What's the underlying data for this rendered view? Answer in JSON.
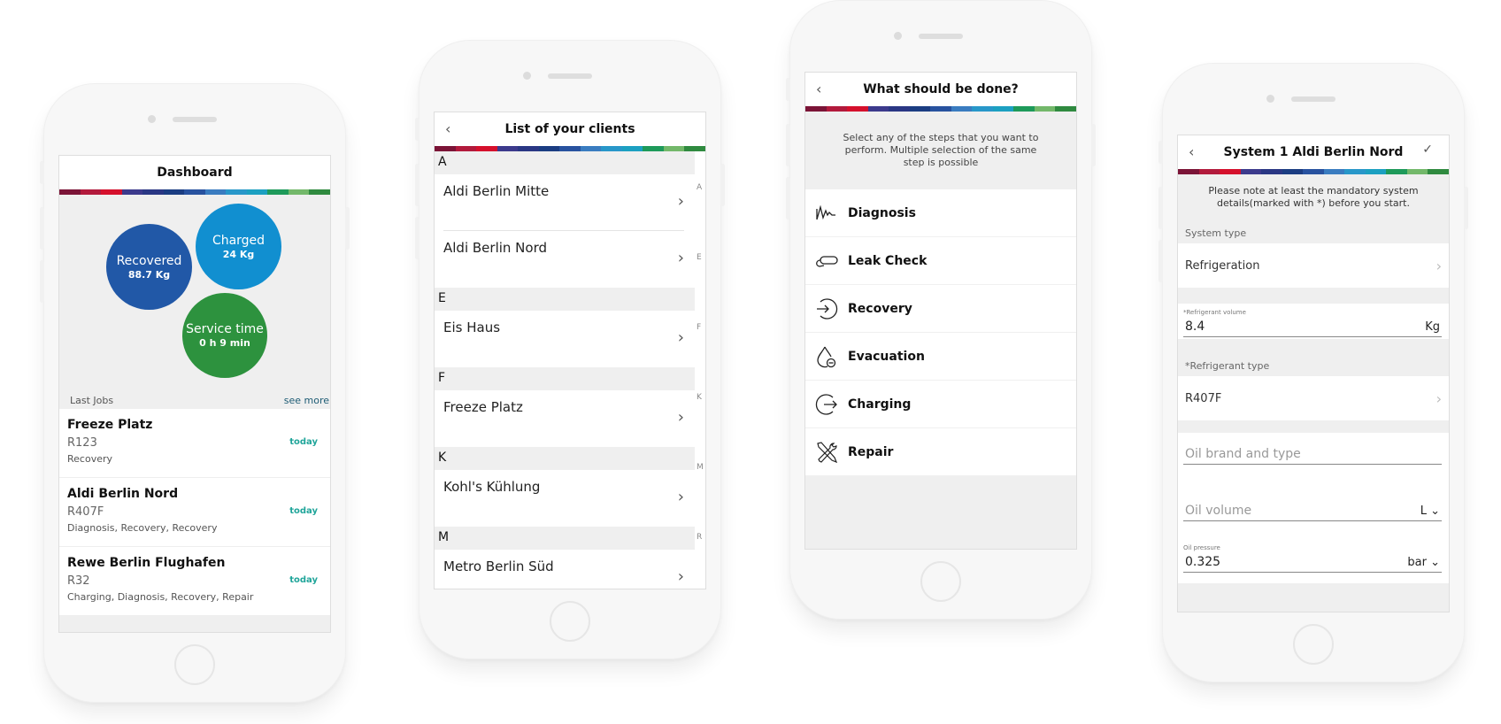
{
  "brand_bar": [
    "#7b1437",
    "#b21a3c",
    "#d5102c",
    "#3c3a8c",
    "#2a3784",
    "#1b3d82",
    "#28529f",
    "#3a7cc0",
    "#2897c9",
    "#1ca0c1",
    "#1e9a5a",
    "#73b86a",
    "#2f8a3f"
  ],
  "dashboard": {
    "title": "Dashboard",
    "bubbles": {
      "recovered": {
        "label": "Recovered",
        "value": "88.7 Kg",
        "color": "#2158a7"
      },
      "charged": {
        "label": "Charged",
        "value": "24 Kg",
        "color": "#118fd0"
      },
      "service": {
        "label": "Service time",
        "value": "0 h 9 min",
        "color": "#2d923e"
      }
    },
    "last_jobs_label": "Last Jobs",
    "see_more": "see more",
    "jobs": [
      {
        "name": "Freeze Platz",
        "ref": "R123",
        "steps": "Recovery",
        "date": "today"
      },
      {
        "name": "Aldi Berlin Nord",
        "ref": "R407F",
        "steps": "Diagnosis, Recovery, Recovery",
        "date": "today"
      },
      {
        "name": "Rewe Berlin Flughafen",
        "ref": "R32",
        "steps": "Charging, Diagnosis, Recovery, Repair",
        "date": "today"
      }
    ]
  },
  "clients": {
    "title": "List of your clients",
    "back": "‹",
    "sections": [
      {
        "letter": "A",
        "items": [
          "Aldi Berlin Mitte",
          "Aldi Berlin Nord"
        ]
      },
      {
        "letter": "E",
        "items": [
          "Eis Haus"
        ]
      },
      {
        "letter": "F",
        "items": [
          "Freeze Platz"
        ]
      },
      {
        "letter": "K",
        "items": [
          "Kohl's Kühlung"
        ]
      },
      {
        "letter": "M",
        "items": [
          "Metro Berlin Süd"
        ]
      }
    ],
    "index": [
      "A",
      "E",
      "F",
      "K",
      "M",
      "R"
    ],
    "chevron": "›"
  },
  "steps": {
    "title": "What should be done?",
    "back": "‹",
    "intro": "Select any of the steps that you want to perform. Multiple selection of the same step is possible",
    "items": [
      {
        "label": "Diagnosis",
        "icon": "diagnosis-icon"
      },
      {
        "label": "Leak Check",
        "icon": "leak-check-icon"
      },
      {
        "label": "Recovery",
        "icon": "recovery-icon"
      },
      {
        "label": "Evacuation",
        "icon": "evacuation-icon"
      },
      {
        "label": "Charging",
        "icon": "charging-icon"
      },
      {
        "label": "Repair",
        "icon": "repair-icon"
      }
    ]
  },
  "system": {
    "title": "System 1 Aldi Berlin Nord",
    "back": "‹",
    "confirm": "✓",
    "note": "Please note at least the mandatory system details(marked with *) before you start.",
    "system_type_label": "System type",
    "system_type_value": "Refrigeration",
    "ref_volume_label": "*Refrigerant volume",
    "ref_volume_value": "8.4",
    "ref_volume_unit": "Kg",
    "ref_type_label": "*Refrigerant type",
    "ref_type_value": "R407F",
    "oil_brand_placeholder": "Oil brand and type",
    "oil_volume_placeholder": "Oil volume",
    "oil_volume_unit": "L",
    "oil_pressure_label": "Oil pressure",
    "oil_pressure_value": "0.325",
    "oil_pressure_unit": "bar",
    "chevron": "›",
    "dropdown": "⌄"
  }
}
